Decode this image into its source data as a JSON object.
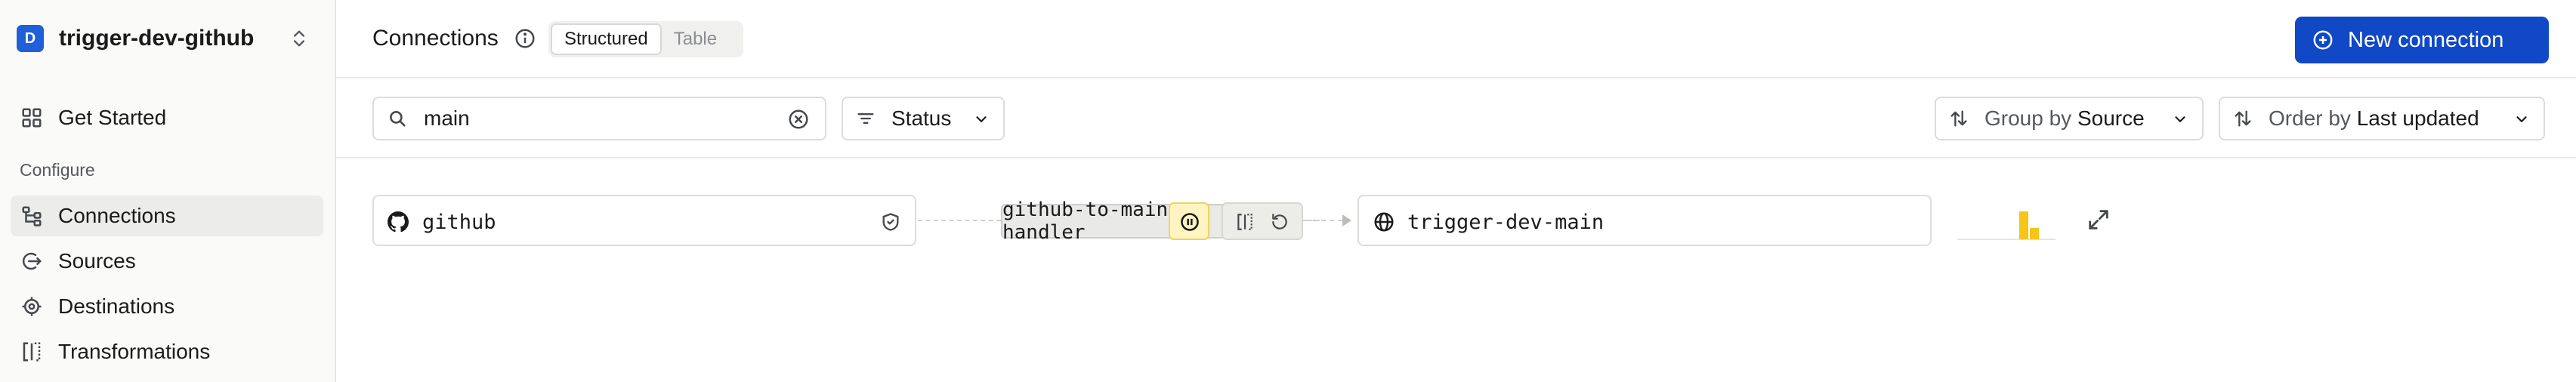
{
  "workspace": {
    "initial": "D",
    "name": "trigger-dev-github"
  },
  "sidebar": {
    "items_top": [
      {
        "label": "Get Started",
        "icon": "grid-icon"
      }
    ],
    "section_label": "Configure",
    "items": [
      {
        "label": "Connections",
        "icon": "connections-icon",
        "active": true
      },
      {
        "label": "Sources",
        "icon": "source-icon"
      },
      {
        "label": "Destinations",
        "icon": "destination-icon"
      },
      {
        "label": "Transformations",
        "icon": "transform-icon"
      }
    ]
  },
  "header": {
    "title": "Connections",
    "views": [
      "Structured",
      "Table"
    ],
    "active_view": "Structured",
    "new_button": "New connection"
  },
  "filters": {
    "search_value": "main",
    "status_label": "Status",
    "group_prefix": "Group by",
    "group_value": "Source",
    "order_prefix": "Order by",
    "order_value": "Last updated"
  },
  "connection": {
    "source": "github",
    "name": "github-to-main-handler",
    "destination": "trigger-dev-main",
    "state": "paused"
  },
  "colors": {
    "primary": "#1048c6",
    "paused_bg": "#fff4c2",
    "sparkline": "#f5c518"
  }
}
